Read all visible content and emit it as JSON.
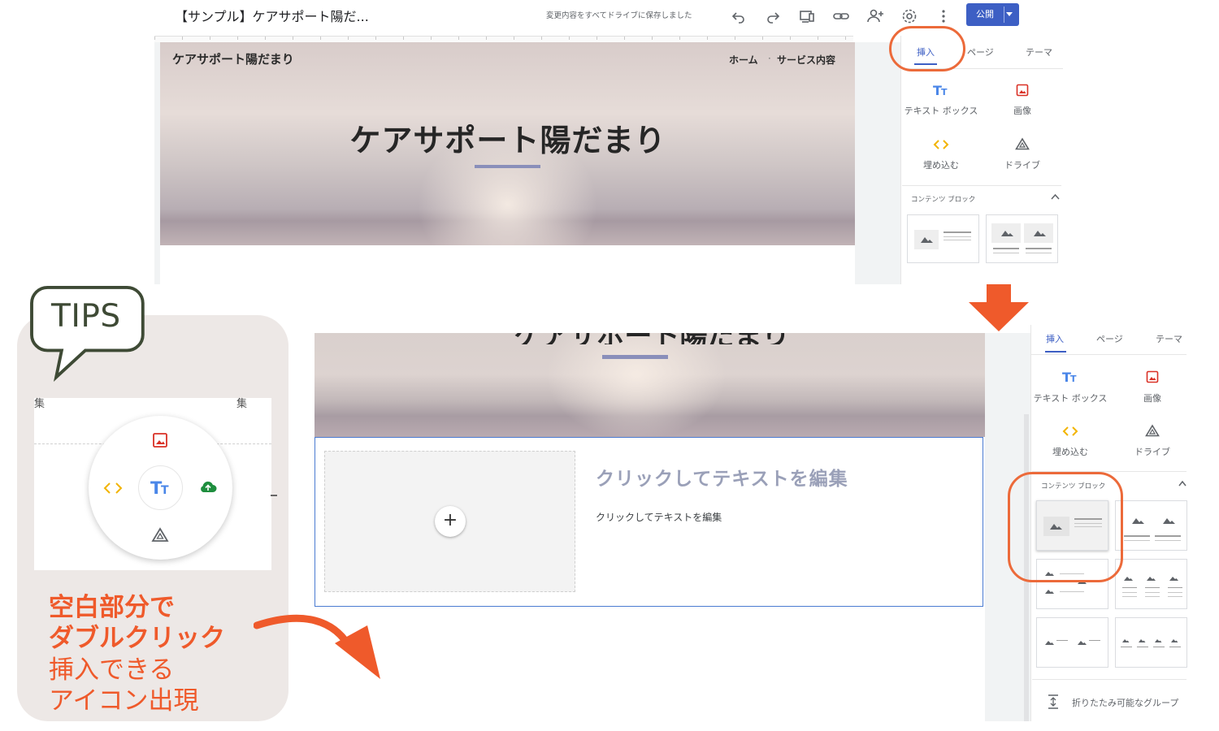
{
  "editor": {
    "doc_title": "【サンプル】ケアサポート陽だ...",
    "save_status": "変更内容をすべてドライブに保存しました",
    "publish_label": "公開",
    "toolbar_icons": [
      "undo-icon",
      "redo-icon",
      "preview-icon",
      "link-icon",
      "share-icon",
      "settings-icon",
      "more-icon"
    ]
  },
  "site": {
    "name": "ケアサポート陽だまり",
    "nav": [
      "ホーム",
      "サービス内容"
    ],
    "nav_separator": "·",
    "hero_title": "ケアサポート陽だまり"
  },
  "panel": {
    "tabs": [
      "挿入",
      "ページ",
      "テーマ"
    ],
    "insert_items": [
      {
        "label": "テキスト ボックス",
        "icon": "text-box-icon"
      },
      {
        "label": "画像",
        "icon": "image-icon"
      },
      {
        "label": "埋め込む",
        "icon": "embed-icon"
      },
      {
        "label": "ドライブ",
        "icon": "drive-icon"
      }
    ],
    "content_blocks_label": "コンテンツ ブロック",
    "collapsible_group_label": "折りたたみ可能なグループ"
  },
  "content_block": {
    "heading": "クリックしてテキストを編集",
    "body": "クリックしてテキストを編集",
    "add_symbol": "+"
  },
  "tips": {
    "badge": "TIPS",
    "edge_chars": [
      "集",
      "集"
    ],
    "line1": "空白部分で",
    "line2": "ダブルクリック",
    "line3": "挿入できる",
    "line4": "アイコン出現",
    "wheel_icons": [
      "image-icon",
      "embed-icon",
      "text-box-icon",
      "upload-icon",
      "drive-icon"
    ]
  },
  "colors": {
    "accent": "#3d5fc4",
    "highlight": "#ec6a3a",
    "tips_text": "#ef5a2b",
    "image_icon": "#d93025",
    "embed_icon": "#f2b400",
    "upload_icon": "#1e8e3e"
  }
}
